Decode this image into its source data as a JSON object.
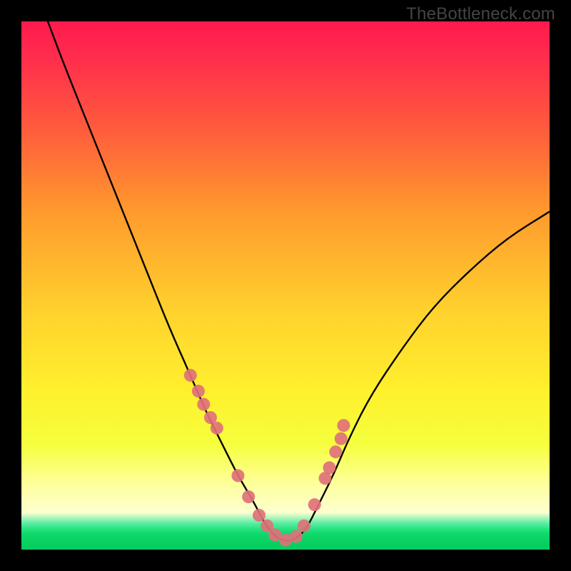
{
  "attribution": "TheBottleneck.com",
  "chart_data": {
    "type": "line",
    "title": "",
    "xlabel": "",
    "ylabel": "",
    "xlim": [
      0,
      100
    ],
    "ylim": [
      0,
      100
    ],
    "series": [
      {
        "name": "bottleneck-curve",
        "x": [
          5,
          8,
          12,
          16,
          20,
          24,
          28,
          32,
          35,
          38,
          41,
          44,
          46,
          48,
          50,
          52,
          54,
          56,
          59,
          62,
          66,
          72,
          78,
          85,
          92,
          100
        ],
        "y": [
          100,
          92,
          82,
          72,
          62,
          52,
          42,
          33,
          26,
          20,
          14,
          9,
          5,
          2.5,
          1.5,
          2,
          4,
          8,
          14,
          21,
          29,
          38,
          46,
          53,
          59,
          64
        ]
      }
    ],
    "points": {
      "name": "highlighted-dots",
      "x": [
        32,
        33.5,
        34.5,
        35.8,
        37,
        41,
        43,
        45,
        46.5,
        48,
        50,
        52,
        53.5,
        55.5,
        57.5,
        58.3,
        59.5,
        60.5,
        61
      ],
      "y": [
        33,
        30,
        27.5,
        25,
        23,
        14,
        10,
        6.5,
        4.5,
        2.8,
        1.8,
        2.5,
        4.5,
        8.5,
        13.5,
        15.5,
        18.5,
        21,
        23.5
      ]
    }
  }
}
